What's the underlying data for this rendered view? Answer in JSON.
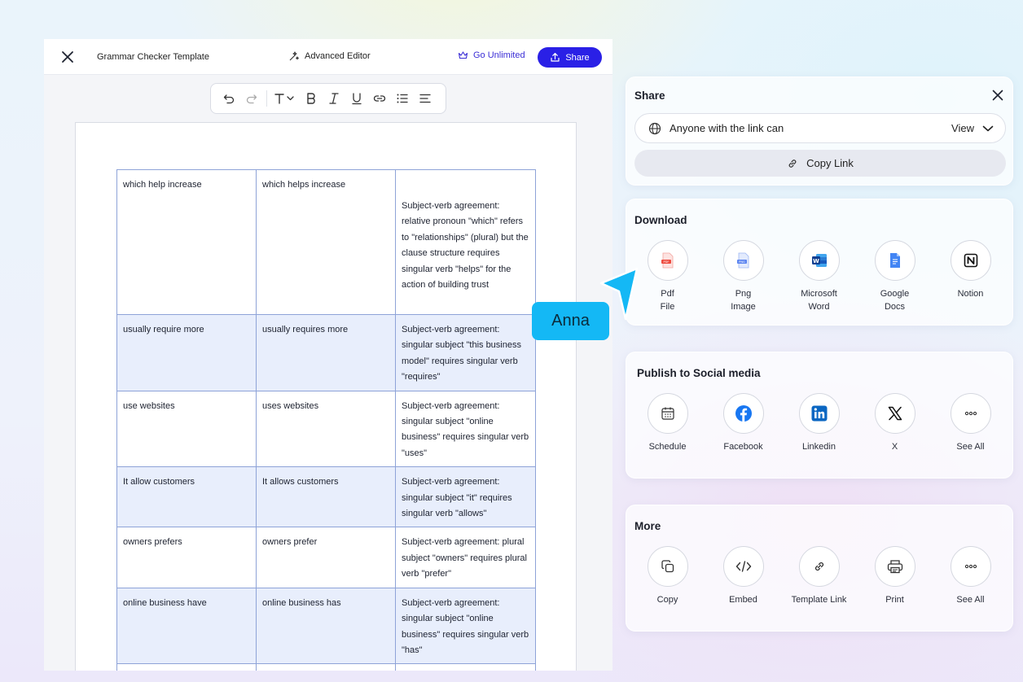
{
  "editor": {
    "title": "Grammar Checker Template",
    "advanced_editor": "Advanced Editor",
    "go_unlimited": "Go Unlimited",
    "share_label": "Share"
  },
  "table": {
    "rows": [
      [
        "which help increase",
        "which helps increase",
        "Subject-verb agreement: relative pronoun \"which\" refers to \"relationships\" (plural) but the clause structure requires singular verb \"helps\" for the action of building trust"
      ],
      [
        "usually require more",
        "usually requires more",
        "Subject-verb agreement: singular subject \"this business model\" requires singular verb \"requires\""
      ],
      [
        "use websites",
        "uses websites",
        "Subject-verb agreement: singular subject \"online business\" requires singular verb \"uses\""
      ],
      [
        "It allow customers",
        "It allows customers",
        "Subject-verb agreement: singular subject \"it\" requires singular verb \"allows\""
      ],
      [
        "owners prefers",
        "owners prefer",
        "Subject-verb agreement: plural subject \"owners\" requires plural verb \"prefer\""
      ],
      [
        "online business have",
        "online business has",
        "Subject-verb agreement: singular subject \"online business\" requires singular verb \"has\""
      ],
      [
        "",
        "",
        ""
      ]
    ]
  },
  "share_panel": {
    "title": "Share",
    "access_text": "Anyone with the link can",
    "access_level": "View",
    "copy_link": "Copy Link"
  },
  "download": {
    "title": "Download",
    "items": [
      "Pdf\nFile",
      "Png\nImage",
      "Microsoft\nWord",
      "Google\nDocs",
      "Notion"
    ]
  },
  "social": {
    "title": "Publish to Social media",
    "items": [
      "Schedule",
      "Facebook",
      "Linkedin",
      "X",
      "See All"
    ]
  },
  "more": {
    "title": "More",
    "items": [
      "Copy",
      "Embed",
      "Template Link",
      "Print",
      "See All"
    ]
  },
  "collaborator": {
    "name": "Anna",
    "color": "#14b8f5"
  },
  "colors": {
    "accent": "#2a20e6",
    "table_border": "#8ea3d8",
    "row_highlight": "#e8eefc"
  }
}
